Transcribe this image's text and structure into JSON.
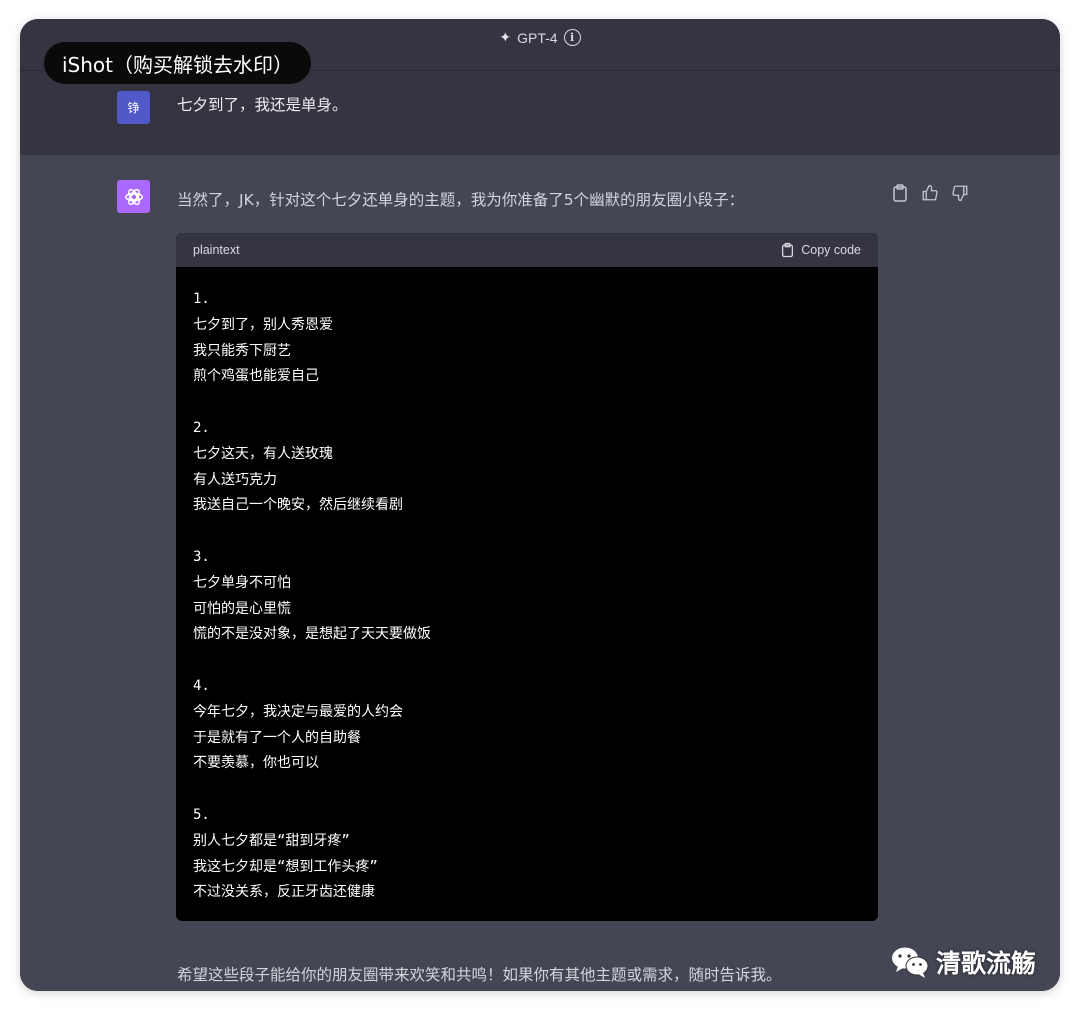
{
  "topbar": {
    "model_label": "GPT-4",
    "info_icon": "i"
  },
  "watermark": {
    "text": "iShot（购买解锁去水印）"
  },
  "user_message": {
    "avatar_initial": "铮",
    "text": "七夕到了，我还是单身。"
  },
  "assistant_message": {
    "intro": "当然了，JK，针对这个七夕还单身的主题，我为你准备了5个幽默的朋友圈小段子：",
    "code_block": {
      "language": "plaintext",
      "copy_label": "Copy code",
      "lines": [
        "1.",
        "七夕到了，别人秀恩爱",
        "我只能秀下厨艺",
        "煎个鸡蛋也能爱自己",
        "",
        "2.",
        "七夕这天，有人送玫瑰",
        "有人送巧克力",
        "我送自己一个晚安，然后继续看剧",
        "",
        "3.",
        "七夕单身不可怕",
        "可怕的是心里慌",
        "慌的不是没对象，是想起了天天要做饭",
        "",
        "4.",
        "今年七夕，我决定与最爱的人约会",
        "于是就有了一个人的自助餐",
        "不要羡慕，你也可以",
        "",
        "5.",
        "别人七夕都是“甜到牙疼”",
        "我这七夕却是“想到工作头疼”",
        "不过没关系，反正牙齿还健康"
      ]
    },
    "closing": "希望这些段子能给你的朋友圈带来欢笑和共鸣！如果你有其他主题或需求，随时告诉我。"
  },
  "brand": {
    "text": "清歌流觞"
  },
  "colors": {
    "header_bg": "#343541",
    "assistant_bg": "#444654",
    "user_avatar": "#5159c8",
    "gpt_avatar": "#ab68ff",
    "code_bg": "#000000"
  }
}
